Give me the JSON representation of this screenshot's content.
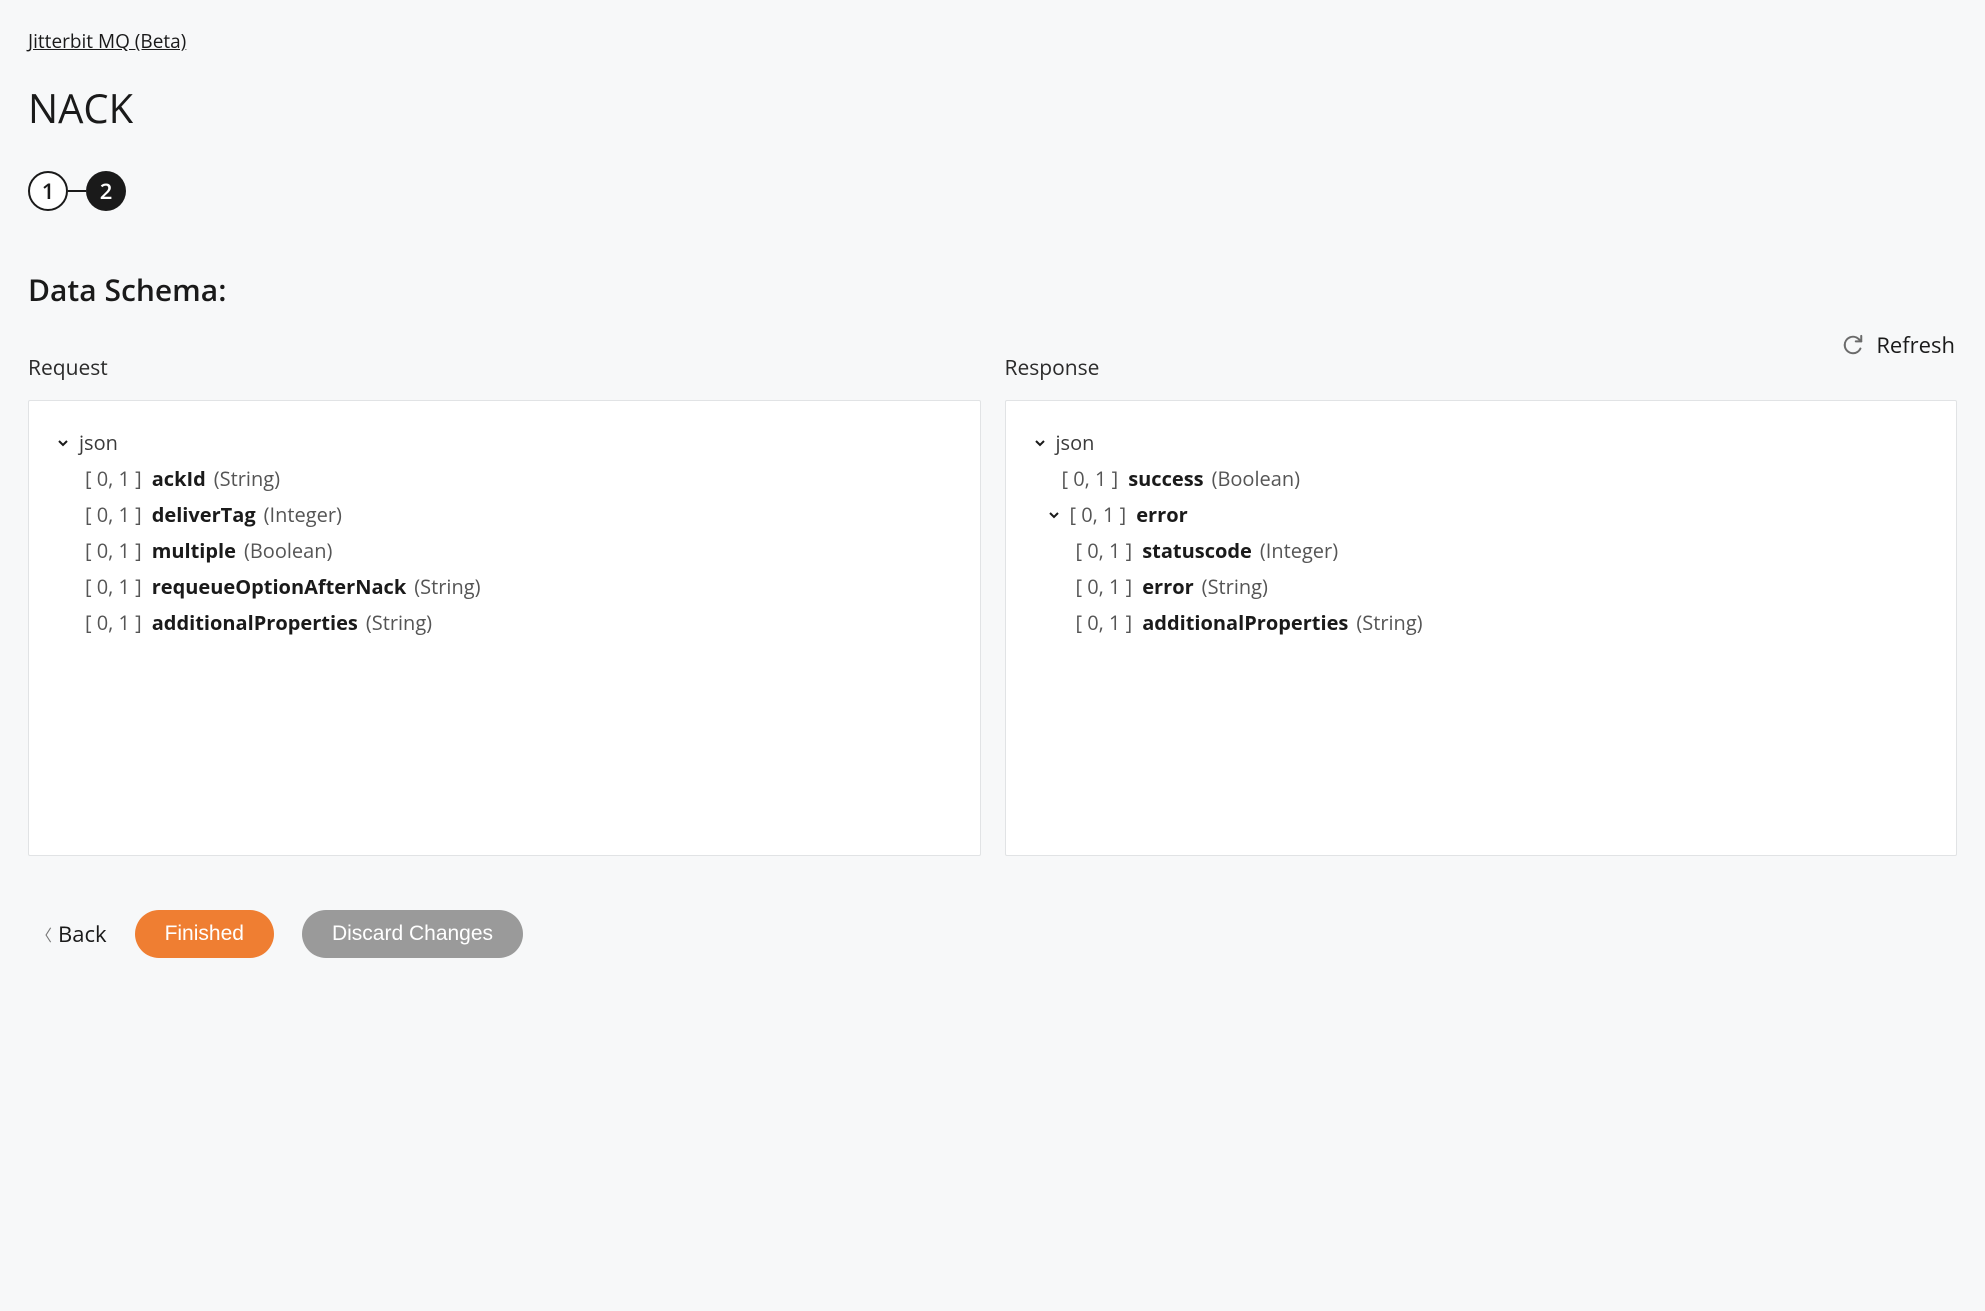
{
  "breadcrumb": {
    "label": "Jitterbit MQ (Beta)"
  },
  "page_title": "NACK",
  "stepper": {
    "step1": "1",
    "step2": "2"
  },
  "section_title": "Data Schema:",
  "refresh_label": "Refresh",
  "request": {
    "title": "Request",
    "root_label": "json",
    "cardinality": "[ 0, 1 ]",
    "fields": [
      {
        "name": "ackId",
        "type": "(String)"
      },
      {
        "name": "deliverTag",
        "type": "(Integer)"
      },
      {
        "name": "multiple",
        "type": "(Boolean)"
      },
      {
        "name": "requeueOptionAfterNack",
        "type": "(String)"
      },
      {
        "name": "additionalProperties",
        "type": "(String)"
      }
    ]
  },
  "response": {
    "title": "Response",
    "root_label": "json",
    "cardinality": "[ 0, 1 ]",
    "success_field": {
      "name": "success",
      "type": "(Boolean)"
    },
    "error_node": {
      "name": "error"
    },
    "error_fields": [
      {
        "name": "statuscode",
        "type": "(Integer)"
      },
      {
        "name": "error",
        "type": "(String)"
      },
      {
        "name": "additionalProperties",
        "type": "(String)"
      }
    ]
  },
  "footer": {
    "back_label": "Back",
    "finished_label": "Finished",
    "discard_label": "Discard Changes"
  }
}
